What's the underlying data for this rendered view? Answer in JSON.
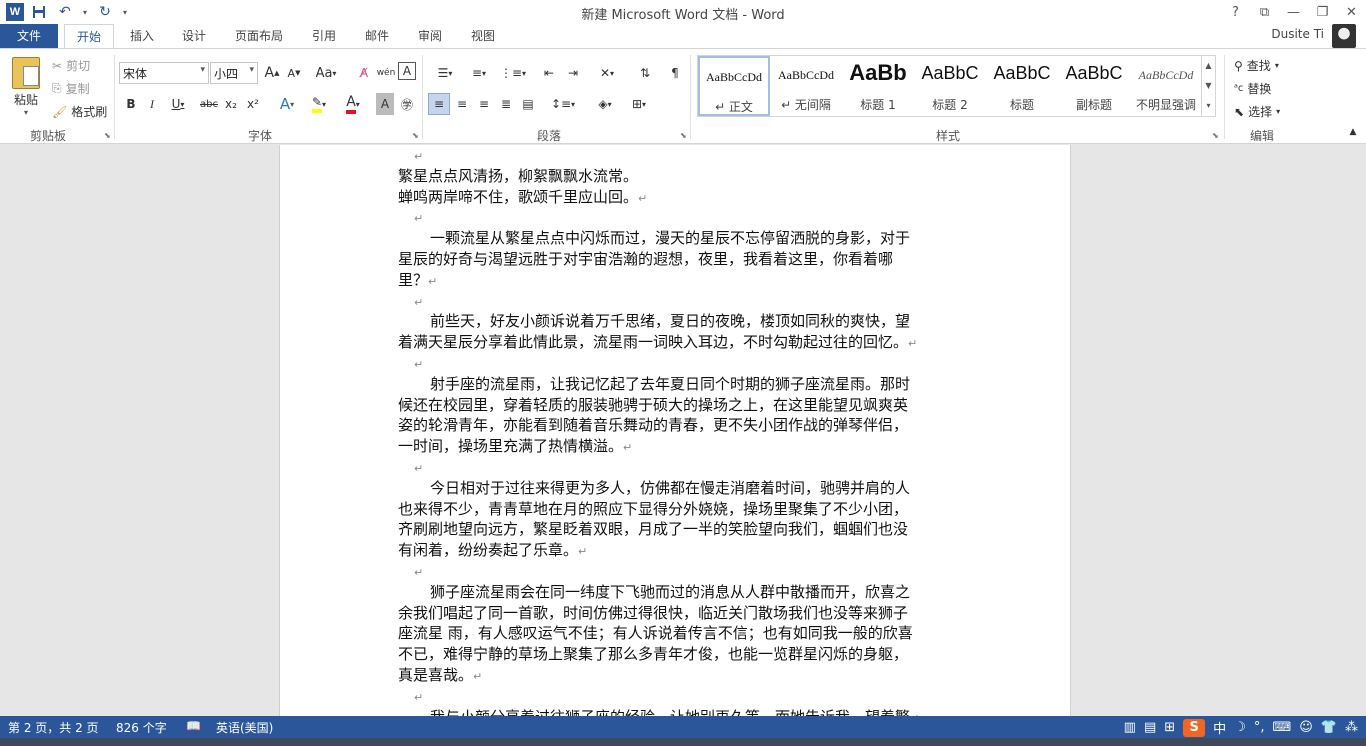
{
  "titlebar": {
    "app_icon": "W",
    "title": "新建 Microsoft Word 文档 - Word",
    "controls": [
      "?",
      "⧉",
      "—",
      "❐",
      "✕"
    ]
  },
  "tabs": {
    "file": "文件",
    "items": [
      "开始",
      "插入",
      "设计",
      "页面布局",
      "引用",
      "邮件",
      "审阅",
      "视图"
    ],
    "active": "开始",
    "user": "Dusite Ti"
  },
  "ribbon": {
    "clipboard": {
      "paste": "粘贴",
      "cut": "剪切",
      "copy": "复制",
      "format_painter": "格式刷",
      "label": "剪贴板"
    },
    "font": {
      "font_name": "宋体",
      "font_size": "小四",
      "grow": "A",
      "shrink": "A",
      "case": "Aa",
      "phonetic": "wén",
      "border_char": "A",
      "bold": "B",
      "italic": "I",
      "underline": "U",
      "strike": "abc",
      "subscript": "x₂",
      "superscript": "x²",
      "label": "字体"
    },
    "paragraph": {
      "label": "段落"
    },
    "styles": {
      "items": [
        {
          "sample": "AaBbCcDd",
          "name": "↵ 正文"
        },
        {
          "sample": "AaBbCcDd",
          "name": "↵ 无间隔"
        },
        {
          "sample": "AaBb",
          "name": "标题 1"
        },
        {
          "sample": "AaBbC",
          "name": "标题 2"
        },
        {
          "sample": "AaBbC",
          "name": "标题"
        },
        {
          "sample": "AaBbC",
          "name": "副标题"
        },
        {
          "sample": "AaBbCcDd",
          "name": "不明显强调"
        }
      ],
      "label": "样式"
    },
    "editing": {
      "find": "查找",
      "replace": "替换",
      "select": "选择",
      "label": "编辑"
    }
  },
  "document": {
    "lines": [
      {
        "text": "",
        "indent": 16
      },
      {
        "text": "繁星点点风清扬，柳絮飘飘水流常。",
        "indent": 0
      },
      {
        "text": "蝉鸣两岸啼不住，歌颂千里应山回。",
        "indent": 0
      },
      {
        "text": "",
        "indent": 16
      },
      {
        "text": "一颗流星从繁星点点中闪烁而过，漫天的星辰不忘停留洒脱的身影，对于",
        "indent": 32
      },
      {
        "text": "星辰的好奇与渴望远胜于对宇宙浩瀚的遐想，夜里，我看着这里，你看着哪",
        "indent": 0
      },
      {
        "text": "里？",
        "indent": 0
      },
      {
        "text": "",
        "indent": 16
      },
      {
        "text": "前些天，好友小颜诉说着万千思绪，夏日的夜晚，楼顶如同秋的爽快，望",
        "indent": 32
      },
      {
        "text": "着满天星辰分享着此情此景，流星雨一词映入耳边，不时勾勒起过往的回忆。",
        "indent": 0
      },
      {
        "text": "",
        "indent": 16
      },
      {
        "text": "射手座的流星雨，让我记忆起了去年夏日同个时期的狮子座流星雨。那时",
        "indent": 32
      },
      {
        "text": "候还在校园里，穿着轻质的服装驰骋于硕大的操场之上，在这里能望见飒爽英",
        "indent": 0
      },
      {
        "text": "姿的轮滑青年，亦能看到随着音乐舞动的青春，更不失小团作战的弹琴伴侣，",
        "indent": 0
      },
      {
        "text": "一时间，操场里充满了热情横溢。",
        "indent": 0
      },
      {
        "text": "",
        "indent": 16
      },
      {
        "text": "今日相对于过往来得更为多人，仿佛都在慢走消磨着时间，驰骋并肩的人",
        "indent": 32
      },
      {
        "text": "也来得不少，青青草地在月的照应下显得分外娆娆，操场里聚集了不少小团，",
        "indent": 0
      },
      {
        "text": "齐刷刷地望向远方，繁星眨着双眼，月成了一半的笑脸望向我们，蝈蝈们也没",
        "indent": 0
      },
      {
        "text": "有闲着，纷纷奏起了乐章。",
        "indent": 0
      },
      {
        "text": "",
        "indent": 16
      },
      {
        "text": "狮子座流星雨会在同一纬度下飞驰而过的消息从人群中散播而开，欣喜之",
        "indent": 32
      },
      {
        "text": "余我们唱起了同一首歌，时间仿佛过得很快，临近关门散场我们也没等来狮子",
        "indent": 0
      },
      {
        "text": "座流星  雨，有人感叹运气不佳；有人诉说着传言不信；也有如同我一般的欣喜",
        "indent": 0
      },
      {
        "text": "不已，难得宁静的草场上聚集了那么多青年才俊，也能一览群星闪烁的身躯，",
        "indent": 0
      },
      {
        "text": "真是喜哉。",
        "indent": 0
      },
      {
        "text": "",
        "indent": 16
      },
      {
        "text": "我与小颜分享着过往狮子座的经验，让她别再久等，而她告诉我，望着繁",
        "indent": 32
      }
    ],
    "pilcrow": "↵"
  },
  "statusbar": {
    "page": "第 2 页，共 2 页",
    "words": "826 个字",
    "language": "英语(美国)",
    "ime": "中"
  },
  "colors": {
    "accent": "#2b579a"
  }
}
